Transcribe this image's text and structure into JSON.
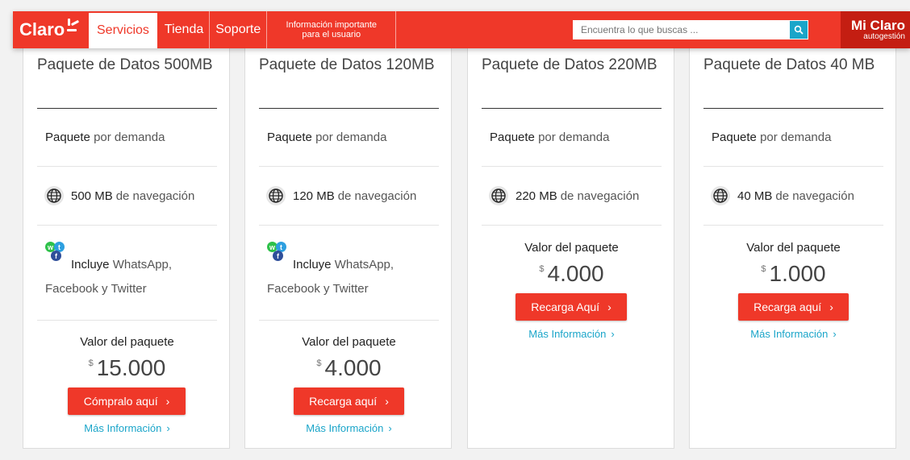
{
  "header": {
    "logo": "Claro",
    "nav": [
      "Servicios",
      "Tienda",
      "Soporte"
    ],
    "info_line1": "Información importante",
    "info_line2": "para el usuario",
    "search_placeholder": "Encuentra lo que buscas ...",
    "miclaro_title": "Mi Claro",
    "miclaro_sub": "autogestión"
  },
  "colors": {
    "brand_red": "#ef3829",
    "dark_red": "#c41e12",
    "link_blue": "#1aa5c9"
  },
  "cards": [
    {
      "title": "Paquete de Datos 500MB",
      "type_strong": "Paquete",
      "type_rest": "por demanda",
      "nav_strong": "500 MB",
      "nav_rest": "de navegación",
      "social_strong": "Incluye",
      "social_rest": "WhatsApp,",
      "social_line2": "Facebook y Twitter",
      "valor": "Valor del paquete",
      "currency": "$",
      "price": "15.000",
      "button": "Cómpralo aquí",
      "more": "Más Información"
    },
    {
      "title": "Paquete de Datos 120MB",
      "type_strong": "Paquete",
      "type_rest": "por demanda",
      "nav_strong": "120 MB",
      "nav_rest": "de navegación",
      "social_strong": "Incluye",
      "social_rest": "WhatsApp,",
      "social_line2": "Facebook y Twitter",
      "valor": "Valor del paquete",
      "currency": "$",
      "price": "4.000",
      "button": "Recarga aquí",
      "more": "Más Información"
    },
    {
      "title": "Paquete de Datos 220MB",
      "type_strong": "Paquete",
      "type_rest": "por demanda",
      "nav_strong": "220 MB",
      "nav_rest": "de navegación",
      "valor": "Valor del paquete",
      "currency": "$",
      "price": "4.000",
      "button": "Recarga Aquí",
      "more": "Más Información"
    },
    {
      "title": "Paquete de Datos 40 MB",
      "type_strong": "Paquete",
      "type_rest": "por demanda",
      "nav_strong": "40 MB",
      "nav_rest": "de navegación",
      "valor": "Valor del paquete",
      "currency": "$",
      "price": "1.000",
      "button": "Recarga aquí",
      "more": "Más Información"
    }
  ]
}
